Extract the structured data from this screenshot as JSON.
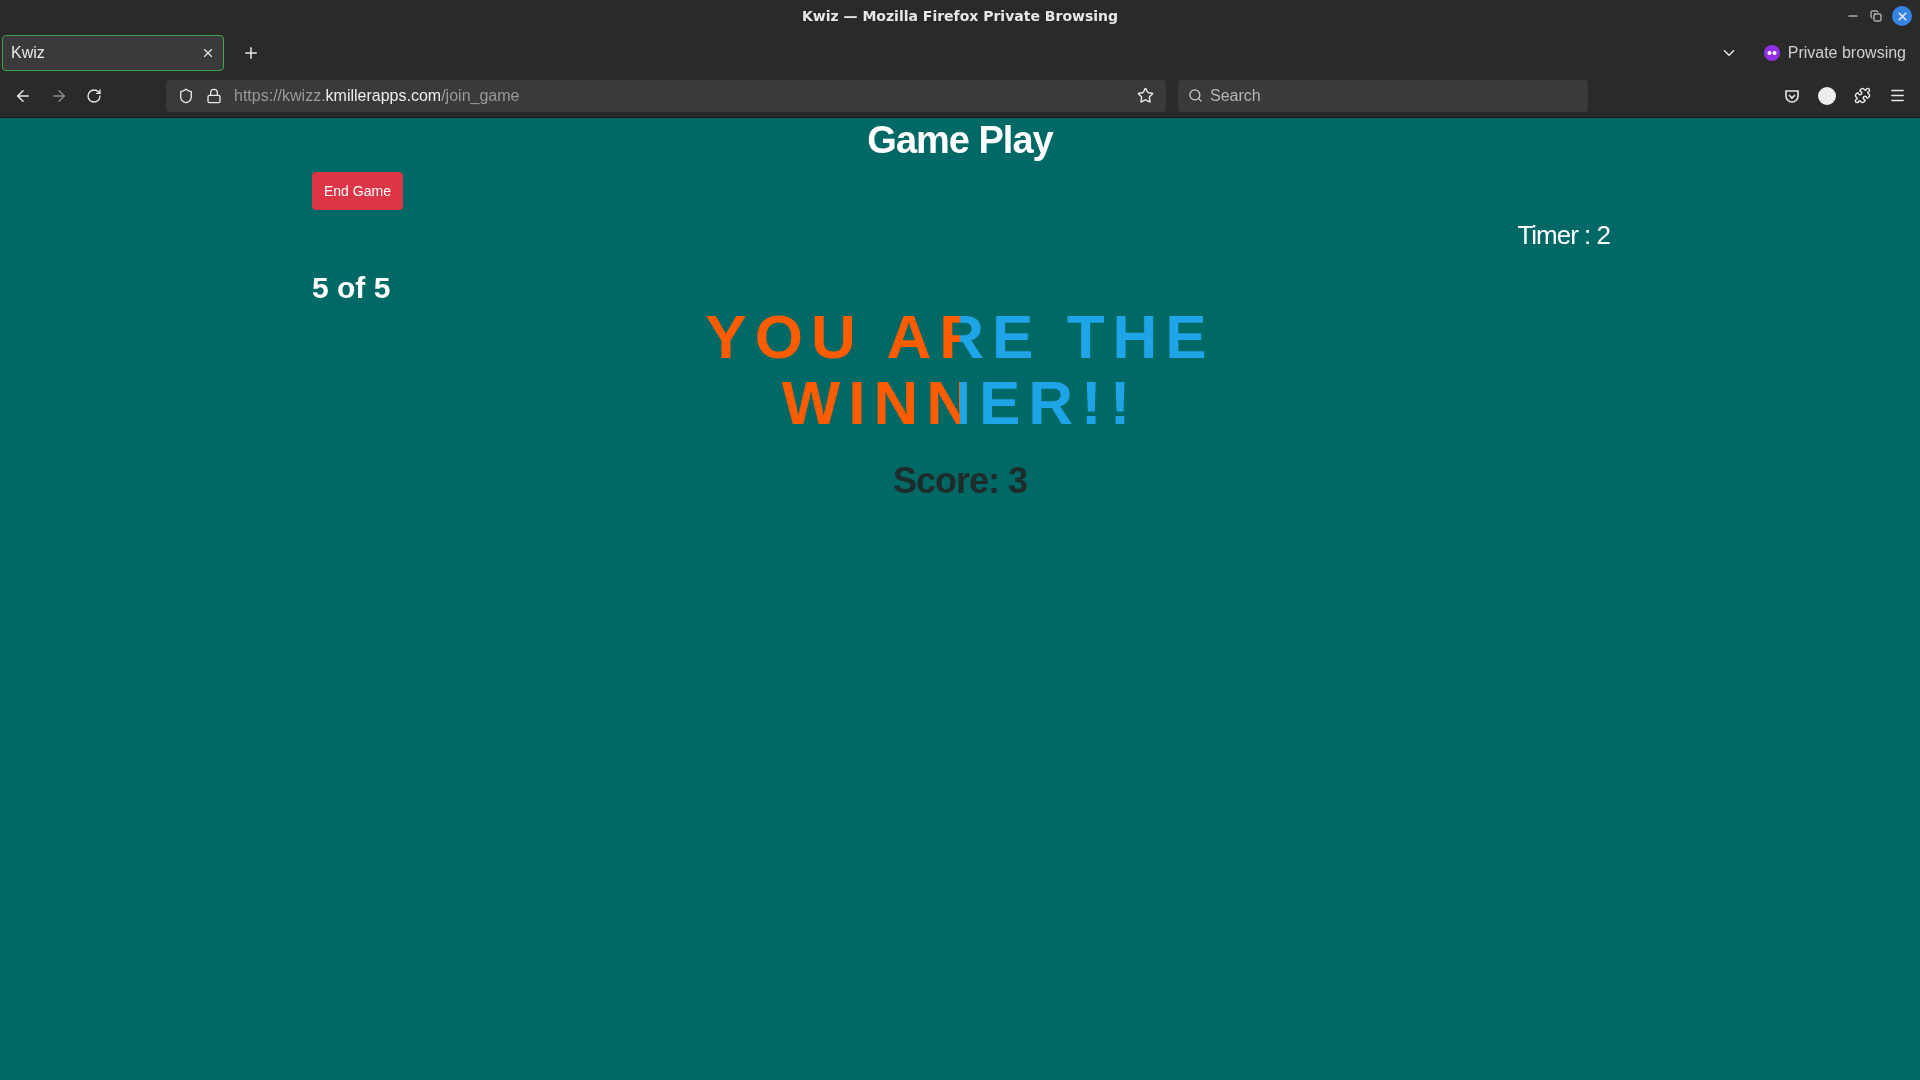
{
  "window": {
    "title": "Kwiz — Mozilla Firefox Private Browsing"
  },
  "tabs": [
    {
      "label": "Kwiz",
      "selected": true
    }
  ],
  "private_label": "Private browsing",
  "address_bar": {
    "prefix": "https://kwizz.",
    "domain": "kmillerapps.com",
    "path": "/join_game"
  },
  "search": {
    "placeholder": "Search"
  },
  "page": {
    "heading": "Game Play",
    "end_button": "End Game",
    "timer": "Timer : 2",
    "progress": "5 of 5",
    "result": "YOU ARE THE WINNER!!",
    "score": "Score: 3"
  }
}
